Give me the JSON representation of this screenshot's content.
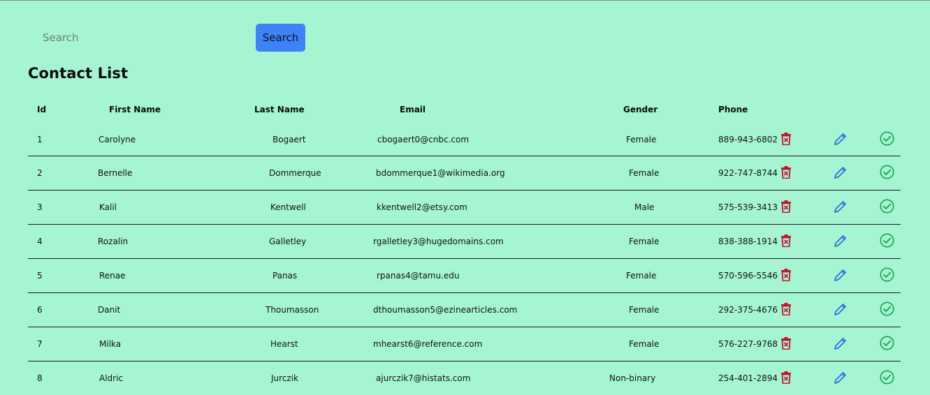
{
  "search": {
    "placeholder": "Search",
    "button_label": "Search"
  },
  "page_title": "Contact List",
  "table": {
    "headers": {
      "id": "Id",
      "first_name": "First Name",
      "last_name": "Last Name",
      "email": "Email",
      "gender": "Gender",
      "phone": "Phone"
    },
    "rows": [
      {
        "id": "1",
        "first_name": "Carolyne",
        "last_name": "Bogaert",
        "email": "cbogaert0@cnbc.com",
        "gender": "Female",
        "phone": "889-943-6802"
      },
      {
        "id": "2",
        "first_name": "Bernelle",
        "last_name": "Dommerque",
        "email": "bdommerque1@wikimedia.org",
        "gender": "Female",
        "phone": "922-747-8744"
      },
      {
        "id": "3",
        "first_name": "Kalil",
        "last_name": "Kentwell",
        "email": "kkentwell2@etsy.com",
        "gender": "Male",
        "phone": "575-539-3413"
      },
      {
        "id": "4",
        "first_name": "Rozalin",
        "last_name": "Galletley",
        "email": "rgalletley3@hugedomains.com",
        "gender": "Female",
        "phone": "838-388-1914"
      },
      {
        "id": "5",
        "first_name": "Renae",
        "last_name": "Panas",
        "email": "rpanas4@tamu.edu",
        "gender": "Female",
        "phone": "570-596-5546"
      },
      {
        "id": "6",
        "first_name": "Danit",
        "last_name": "Thoumasson",
        "email": "dthoumasson5@ezinearticles.com",
        "gender": "Female",
        "phone": "292-375-4676"
      },
      {
        "id": "7",
        "first_name": "Milka",
        "last_name": "Hearst",
        "email": "mhearst6@reference.com",
        "gender": "Female",
        "phone": "576-227-9768"
      },
      {
        "id": "8",
        "first_name": "Aldric",
        "last_name": "Jurczik",
        "email": "ajurczik7@histats.com",
        "gender": "Non-binary",
        "phone": "254-401-2894"
      }
    ]
  },
  "icons": {
    "delete": "trash-icon",
    "edit": "pencil-icon",
    "confirm": "check-circle-icon"
  },
  "colors": {
    "background": "#a5f5d3",
    "primary_button": "#3d82f7",
    "delete_icon": "#c8102e",
    "edit_icon": "#2f6ee6",
    "confirm_icon": "#19a34a"
  }
}
